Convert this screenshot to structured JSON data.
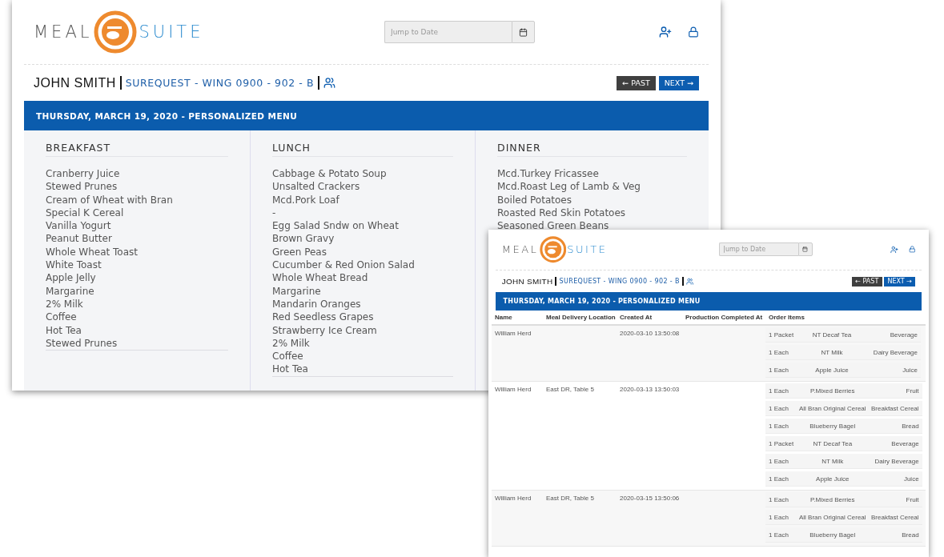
{
  "menu_window": {
    "logo": {
      "left": "MEAL",
      "right": "SUITE"
    },
    "date_field": {
      "placeholder": "Jump to Date"
    },
    "resident": {
      "name": "JOHN SMITH",
      "location": "SUREQUEST - WING 0900 - 902 - B"
    },
    "nav_buttons": [
      "← PAST",
      "NEXT →"
    ],
    "banner": "THURSDAY, MARCH 19, 2020 - PERSONALIZED MENU",
    "columns": [
      {
        "heading": "BREAKFAST",
        "items": [
          "Cranberry Juice",
          "Stewed Prunes",
          "Cream of Wheat with Bran",
          "Special K Cereal",
          "Vanilla Yogurt",
          "Peanut Butter",
          "Whole Wheat Toast",
          "White Toast",
          "Apple Jelly",
          "Margarine",
          "2% Milk",
          "Coffee",
          "Hot Tea",
          "Stewed Prunes"
        ]
      },
      {
        "heading": "LUNCH",
        "items": [
          "Cabbage & Potato Soup",
          "Unsalted Crackers",
          "Mcd.Pork Loaf",
          "-",
          "Egg Salad Sndw on Wheat",
          "Brown Gravy",
          "Green Peas",
          "Cucumber & Red Onion Salad",
          "Whole Wheat Bread",
          "Margarine",
          "Mandarin Oranges",
          "Red Seedless Grapes",
          "Strawberry Ice Cream",
          "2% Milk",
          "Coffee",
          "Hot Tea"
        ]
      },
      {
        "heading": "DINNER",
        "items": [
          "Mcd.Turkey Fricassee",
          "Mcd.Roast Leg of Lamb & Veg",
          "Boiled Potatoes",
          "Roasted Red Skin Potatoes",
          "Seasoned Green Beans"
        ]
      }
    ]
  },
  "orders_window": {
    "logo": {
      "left": "MEAL",
      "right": "SUITE"
    },
    "date_field": {
      "placeholder": "Jump to Date"
    },
    "resident": {
      "name": "JOHN SMITH",
      "location": "SUREQUEST - WING 0900 - 902 - B"
    },
    "nav_buttons": [
      "← PAST",
      "NEXT →"
    ],
    "banner": "THURSDAY, MARCH 19, 2020 - PERSONALIZED MENU",
    "table": {
      "columns": [
        "Name",
        "Meal Delivery Location",
        "Created At",
        "Production Completed At",
        "Order Items"
      ],
      "rows": [
        {
          "name": "William Herd",
          "created_at": "2020-03-10 13:50:08",
          "items": [
            {
              "qty": "1 Packet",
              "item": "NT Decaf Tea",
              "category": "Beverage"
            },
            {
              "qty": "1 Each",
              "item": "NT Milk",
              "category": "Dairy Beverage"
            },
            {
              "qty": "1 Each",
              "item": "Apple Juice",
              "category": "Juice"
            }
          ]
        },
        {
          "name": "William Herd",
          "location": "East DR, Table 5",
          "created_at": "2020-03-13 13:50:03",
          "items": [
            {
              "qty": "1 Each",
              "item": "P.Mixed Berries",
              "category": "Fruit"
            },
            {
              "qty": "1 Each",
              "item": "All Bran Original Cereal",
              "category": "Breakfast Cereal"
            },
            {
              "qty": "1 Each",
              "item": "Blueberry Bagel",
              "category": "Bread"
            },
            {
              "qty": "1 Packet",
              "item": "NT Decaf Tea",
              "category": "Beverage"
            },
            {
              "qty": "1 Each",
              "item": "NT Milk",
              "category": "Dairy Beverage"
            },
            {
              "qty": "1 Each",
              "item": "Apple Juice",
              "category": "Juice"
            }
          ]
        },
        {
          "name": "William Herd",
          "location": "East DR, Table 5",
          "created_at": "2020-03-15 13:50:06",
          "items": [
            {
              "qty": "1 Each",
              "item": "P.Mixed Berries",
              "category": "Fruit"
            },
            {
              "qty": "1 Each",
              "item": "All Bran Original Cereal",
              "category": "Breakfast Cereal"
            },
            {
              "qty": "1 Each",
              "item": "Blueberry Bagel",
              "category": "Bread"
            }
          ]
        }
      ]
    }
  }
}
